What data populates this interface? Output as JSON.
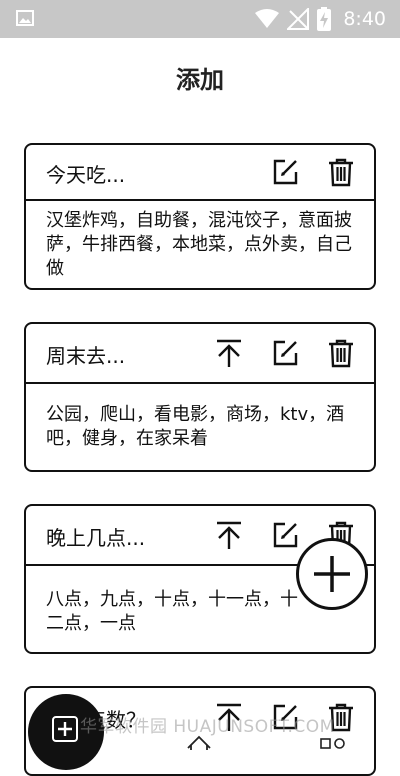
{
  "status_bar": {
    "time": "8:40"
  },
  "page": {
    "title": "添加"
  },
  "cards": [
    {
      "title": "今天吃...",
      "body": "汉堡炸鸡，自助餐，混沌饺子，意面披萨，牛排西餐，本地菜，点外卖，自己做"
    },
    {
      "title": "周末去...",
      "body": "公园，爬山，看电影，商场，ktv，酒吧，健身，在家呆着"
    },
    {
      "title": "晚上几点...",
      "body": "八点，九点，十点，十一点，十二点，一点"
    },
    {
      "title": "点数？"
    }
  ],
  "watermark": "华军软件园 HUAJUNSOFT.COM",
  "icons": {
    "edit": "edit-icon",
    "delete": "trash-icon",
    "pin_top": "pin-top-icon",
    "add": "plus-icon"
  }
}
